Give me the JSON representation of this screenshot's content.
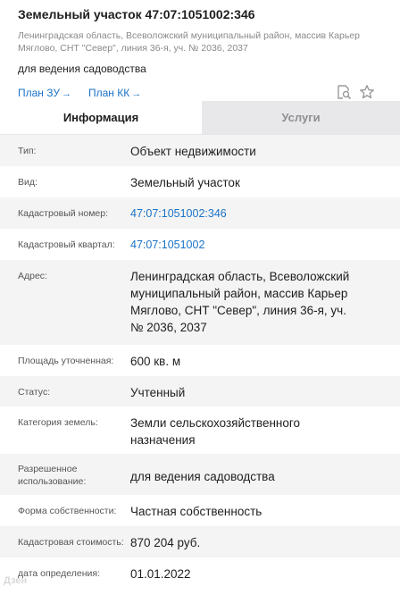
{
  "header": {
    "title": "Земельный участок 47:07:1051002:346",
    "address_line1": "Ленинградская область, Всеволожский муниципальный район, массив Карьер",
    "address_line2": "Мяглово, СНТ \"Север\", линия 36-я, уч. № 2036, 2037",
    "purpose": "для ведения садоводства"
  },
  "links": {
    "plan_zu": "План ЗУ",
    "plan_kk": "План КК",
    "arrow": "→"
  },
  "icons": {
    "search": "search-document-icon",
    "favorite": "star-icon",
    "icon_color": "#9a9a9a"
  },
  "tabs": [
    {
      "label": "Информация",
      "active": true
    },
    {
      "label": "Услуги",
      "active": false
    }
  ],
  "rows": [
    {
      "label": "Тип:",
      "value": [
        "Объект недвижимости"
      ]
    },
    {
      "label": "Вид:",
      "value": [
        "Земельный участок"
      ]
    },
    {
      "label": "Кадастровый номер:",
      "value": [
        "47:07:1051002:346"
      ],
      "link": true
    },
    {
      "label": "Кадастровый квартал:",
      "value": [
        "47:07:1051002"
      ],
      "link": true
    },
    {
      "label": "Адрес:",
      "value": [
        "Ленинградская область, Всеволожский",
        "муниципальный район, массив Карьер",
        "Мяглово, СНТ \"Север\", линия 36-я, уч.",
        "№ 2036, 2037"
      ]
    },
    {
      "label": "Площадь уточненная:",
      "value": [
        "600 кв. м"
      ]
    },
    {
      "label": "Статус:",
      "value": [
        "Учтенный"
      ]
    },
    {
      "label": "Категория земель:",
      "value": [
        "Земли сельскохозяйственного",
        "назначения"
      ]
    },
    {
      "label": [
        "Разрешенное",
        "использование:"
      ],
      "value": [
        "для ведения садоводства"
      ]
    },
    {
      "label": "Форма собственности:",
      "value": [
        "Частная собственность"
      ]
    },
    {
      "label": "Кадастровая стоимость:",
      "value": [
        "870 204 руб."
      ]
    },
    {
      "label": "дата определения:",
      "value": [
        "01.01.2022"
      ]
    }
  ],
  "watermark": "Дзен",
  "colors": {
    "link": "#1a73c7",
    "row_alt": "#f4f4f4",
    "tab_inactive_bg": "#e8e8ea"
  }
}
